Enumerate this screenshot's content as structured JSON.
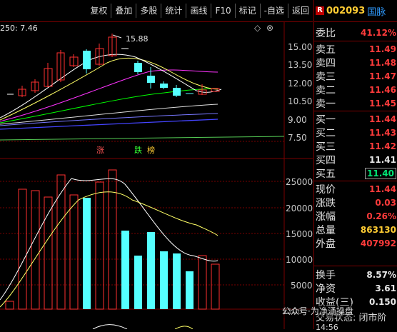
{
  "toolbar": {
    "buttons": [
      "复权",
      "叠加",
      "多股",
      "统计",
      "画线",
      "F10",
      "标记",
      "-自选",
      "返回"
    ]
  },
  "kline": {
    "ma_label": "250: 7.46",
    "max_label": "15.88",
    "price_ticks": [
      "15.00",
      "13.50",
      "12.00",
      "10.50",
      "9.00",
      "7.50"
    ],
    "volume_ticks": [
      "25000",
      "20000",
      "15000",
      "10000",
      "5000"
    ],
    "tags": [
      "涨",
      "跌",
      "榜"
    ],
    "volume_multiplier": "X100"
  },
  "colors": {
    "up": "#ff3030",
    "down": "#55ffff",
    "ma5": "#ffffff",
    "ma10": "#ffff66",
    "ma20": "#ff33ff",
    "ma30": "#00ff00",
    "ma60": "#dddddd",
    "ma120": "#4444ff",
    "ma250": "#55cc55"
  },
  "quote": {
    "market_badge": "R",
    "code": "002093",
    "name": "国脉",
    "weibi": {
      "label": "委比",
      "value": "41.12%"
    },
    "asks": [
      {
        "label": "卖五",
        "value": "11.49"
      },
      {
        "label": "卖四",
        "value": "11.48"
      },
      {
        "label": "卖三",
        "value": "11.47"
      },
      {
        "label": "卖二",
        "value": "11.46"
      },
      {
        "label": "卖一",
        "value": "11.45"
      }
    ],
    "bids": [
      {
        "label": "买一",
        "value": "11.44"
      },
      {
        "label": "买二",
        "value": "11.43"
      },
      {
        "label": "买三",
        "value": "11.42"
      },
      {
        "label": "买四",
        "value": "11.41"
      },
      {
        "label": "买五",
        "value": "11.40"
      }
    ],
    "stats1": [
      {
        "label": "现价",
        "value": "11.44"
      },
      {
        "label": "涨跌",
        "value": "0.03"
      },
      {
        "label": "涨幅",
        "value": "0.26%"
      },
      {
        "label": "总量",
        "value": "863130"
      },
      {
        "label": "外盘",
        "value": "407992"
      }
    ],
    "stats2": [
      {
        "label": "换手",
        "value": "8.57%"
      },
      {
        "label": "净资",
        "value": "3.61"
      },
      {
        "label": "收益(三)",
        "value": "0.150"
      }
    ],
    "trade_status": "交易状态: 闭市阶",
    "time": "14:56"
  },
  "watermark": "公众号·为净涌操盘"
}
